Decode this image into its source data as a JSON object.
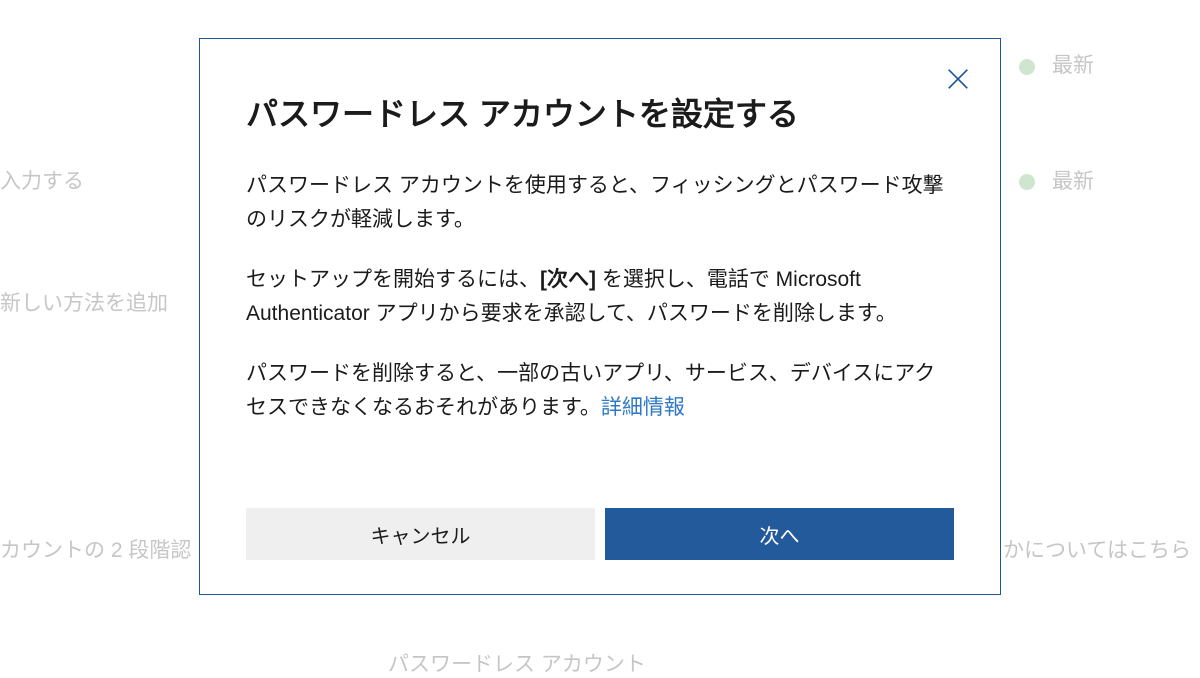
{
  "background": {
    "text1": "最新",
    "text2": "入力する",
    "text3": "最新",
    "text4": "新しい方法を追加",
    "text5": "カウントの 2 段階認",
    "text6": "かについてはこちら",
    "text7": "パスワードレス アカウント"
  },
  "modal": {
    "title": "パスワードレス アカウントを設定する",
    "paragraph1": "パスワードレス アカウントを使用すると、フィッシングとパスワード攻撃のリスクが軽減します。",
    "paragraph2_pre": "セットアップを開始するには、",
    "paragraph2_bold": "[次へ]",
    "paragraph2_post": " を選択し、電話で Microsoft Authenticator アプリから要求を承認して、パスワードを削除します。",
    "paragraph3_pre": "パスワードを削除すると、一部の古いアプリ、サービス、デバイスにアクセスできなくなるおそれがあります。",
    "learn_more": "詳細情報",
    "cancel_label": "キャンセル",
    "next_label": "次へ"
  }
}
